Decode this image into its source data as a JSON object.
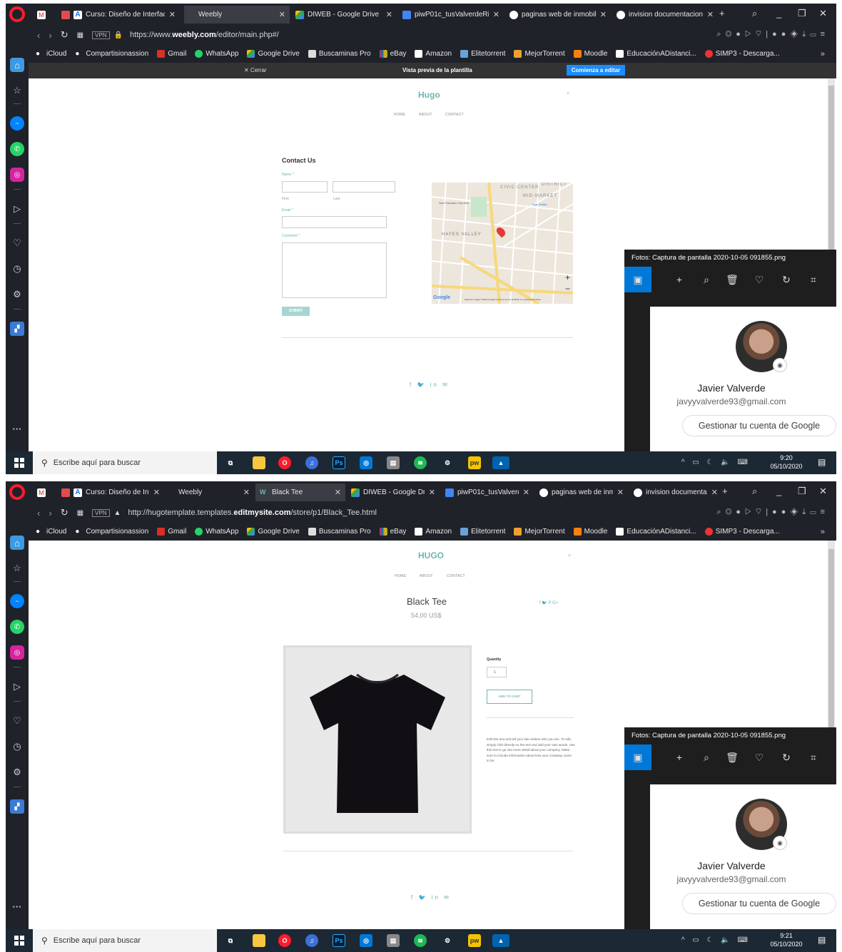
{
  "shot1": {
    "tabs": [
      {
        "label": "Curso: Diseño de Interfac"
      },
      {
        "label": "Weebly"
      },
      {
        "label": "DIWEB - Google Drive"
      },
      {
        "label": "piwP01c_tusValverdeRive"
      },
      {
        "label": "paginas web de inmobilia"
      },
      {
        "label": "invision documentacion"
      }
    ],
    "url": {
      "prefix": "https://www.",
      "domain": "weebly.com",
      "path": "/editor/main.php#/"
    },
    "preview_bar": {
      "close": "✕ Cerrar",
      "title": "Vista previa de la plantilla",
      "start": "Comienza a editar"
    },
    "site": {
      "title": "Hugo",
      "nav": [
        "HOME",
        "ABOUT",
        "CONTACT"
      ],
      "contact": {
        "heading": "Contact Us",
        "name_label": "Name *",
        "first": "First",
        "last": "Last",
        "email_label": "Email *",
        "comment_label": "Comment *",
        "submit": "SUBMIT"
      },
      "map": {
        "districts": [
          "CIVIC CENTER",
          "DISTRICT",
          "MID-MARKET",
          "HAYES VALLEY"
        ],
        "poi1": "San Francisco City Hall",
        "poi2": "Civic Center",
        "attribution": "Datos de mapas ©2020 Google  Términos de uso  Notificar un problema de Maps",
        "google": "Google"
      },
      "social": "f  🐦  in  ✉"
    },
    "photos": {
      "title": "Fotos: Captura de pantalla 2020-10-05 091855.png",
      "name": "Javier Valverde",
      "email": "javyyvalverde93@gmail.com",
      "manage": "Gestionar tu cuenta de Google"
    },
    "taskbar": {
      "search": "Escribe aquí para buscar",
      "time": "9:20",
      "date": "05/10/2020"
    }
  },
  "shot2": {
    "tabs": [
      {
        "label": "Curso: Diseño de Int"
      },
      {
        "label": "Weebly"
      },
      {
        "label": "Black Tee"
      },
      {
        "label": "DIWEB - Google Dri"
      },
      {
        "label": "piwP01c_tusValverd"
      },
      {
        "label": "paginas web de inm"
      },
      {
        "label": "invision documenta"
      }
    ],
    "url": {
      "prefix": "http://hugotemplate.templates.",
      "domain": "editmysite.com",
      "path": "/store/p1/Black_Tee.html"
    },
    "site": {
      "title": "HUGO",
      "nav": [
        "HOME",
        "ABOUT",
        "CONTACT"
      ],
      "product": {
        "name": "Black Tee",
        "price": "54,00 US$",
        "share": "f  🐦  P  G+",
        "quantity_label": "Quantity",
        "quantity_value": "1",
        "add_to_cart": "ADD TO CART",
        "description": "Edit this text and tell your site visitors who you are. To edit, simply click directly on the text and add your own words. Use this text to go into more detail about your company. Make sure to include information about how your company came to be."
      },
      "social": "f  🐦  in  ✉"
    },
    "photos": {
      "title": "Fotos: Captura de pantalla 2020-10-05 091855.png",
      "name": "Javier Valverde",
      "email": "javyyvalverde93@gmail.com",
      "manage": "Gestionar tu cuenta de Google"
    },
    "taskbar": {
      "search": "Escribe aquí para buscar",
      "time": "9:21",
      "date": "05/10/2020"
    }
  },
  "bookmarks": [
    "iCloud",
    "Compartisionassion",
    "Gmail",
    "WhatsApp",
    "Google Drive",
    "Buscaminas Pro",
    "eBay",
    "Amazon",
    "Elitetorrent",
    "MejorTorrent",
    "Moodle",
    "EducaciónADistanci...",
    "SIMP3 - Descarga..."
  ],
  "colors": {
    "accent": "#6fb5b1",
    "browser_bg": "#1f2229",
    "taskbar": "#1c2833",
    "photos_accent": "#0078d7",
    "opera_red": "#ff1b2d"
  }
}
